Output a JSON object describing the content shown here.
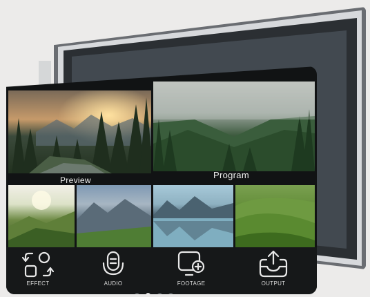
{
  "preview": {
    "label": "Preview"
  },
  "program": {
    "label": "Program"
  },
  "thumbnails": [
    {
      "name": "thumbnail-green-hills-sunrise"
    },
    {
      "name": "thumbnail-mountain-meadow"
    },
    {
      "name": "thumbnail-lake-reflection"
    },
    {
      "name": "thumbnail-terraced-hills"
    }
  ],
  "toolbar": {
    "items": [
      {
        "label": "EFFECT",
        "icon": "effect-icon"
      },
      {
        "label": "AUDIO",
        "icon": "audio-icon"
      },
      {
        "label": "FOOTAGE",
        "icon": "footage-icon"
      },
      {
        "label": "OUTPUT",
        "icon": "output-icon"
      }
    ]
  },
  "pager": {
    "count": 4,
    "active_index": 1
  },
  "colors": {
    "background": "#ecebea",
    "tablet": "#111314",
    "text": "#f1f1f1"
  }
}
